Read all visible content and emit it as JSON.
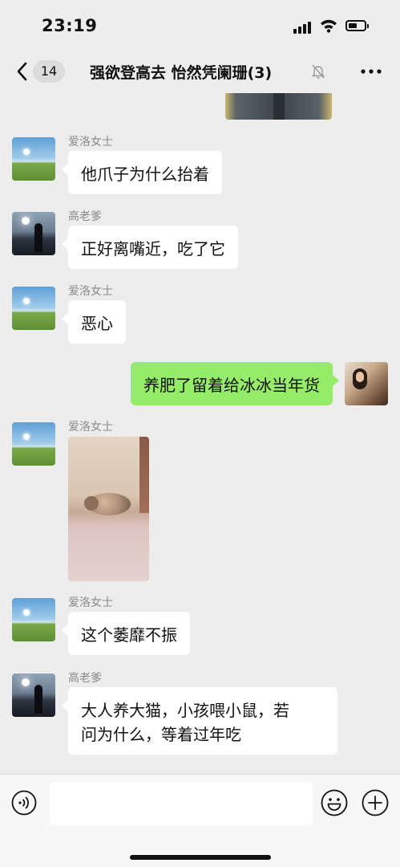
{
  "status_bar": {
    "time": "23:19",
    "battery_level": 0.55
  },
  "header": {
    "back_label": "back",
    "unread_count": "14",
    "title": "强欲登高去 怡然凭阑珊(3)"
  },
  "messages": [
    {
      "type": "image",
      "direction": "incoming",
      "description_icon": "photo"
    },
    {
      "type": "text",
      "direction": "incoming",
      "sender": "爱洛女士",
      "text": "他爪子为什么抬着",
      "avatar": "field-avatar"
    },
    {
      "type": "text",
      "direction": "incoming",
      "sender": "高老爹",
      "text": "正好离嘴近，吃了它",
      "avatar": "silhouette-avatar"
    },
    {
      "type": "text",
      "direction": "incoming",
      "sender": "爱洛女士",
      "text": "恶心",
      "avatar": "field-avatar"
    },
    {
      "type": "text",
      "direction": "outgoing",
      "text": "养肥了留着给冰冰当年货",
      "avatar": "self-avatar"
    },
    {
      "type": "image",
      "direction": "incoming",
      "sender": "爱洛女士",
      "avatar": "field-avatar"
    },
    {
      "type": "text",
      "direction": "incoming",
      "sender": "爱洛女士",
      "text": "这个萎靡不振",
      "avatar": "field-avatar"
    },
    {
      "type": "text",
      "direction": "incoming",
      "sender": "高老爹",
      "text_lines": [
        "大人养大猫，小孩喂小鼠，若",
        "问为什么，等着过年吃"
      ],
      "avatar": "silhouette-avatar"
    }
  ],
  "input_bar": {
    "value": "",
    "icons": [
      "voice-icon",
      "emoji-icon",
      "plus-icon"
    ]
  },
  "colors": {
    "outgoing_bubble": "#95ec69",
    "incoming_bubble": "#ffffff",
    "background": "#ededed"
  }
}
